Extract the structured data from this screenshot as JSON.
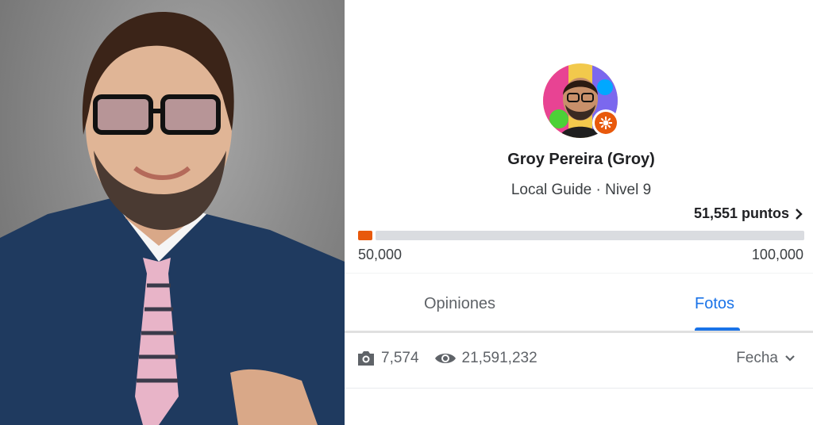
{
  "profile": {
    "name": "Groy Pereira (Groy)",
    "subtitle": "Local Guide · Nivel 9",
    "points_label": "51,551 puntos",
    "progress": {
      "min_label": "50,000",
      "max_label": "100,000",
      "value": 51551,
      "min": 50000,
      "max": 100000
    }
  },
  "tabs": [
    {
      "label": "Opiniones",
      "selected": false
    },
    {
      "label": "Fotos",
      "selected": true
    }
  ],
  "stats": {
    "photos_count": "7,574",
    "views_count": "21,591,232",
    "sort_label": "Fecha"
  },
  "icons": {
    "photo": "camera-icon",
    "views": "eye-icon",
    "sort": "chevron-down-icon",
    "points": "chevron-right-icon",
    "badge": "local-guide-badge-icon"
  },
  "colors": {
    "accent": "#1a73e8",
    "badge": "#e8590c",
    "progress_fill": "#e8590c",
    "progress_track": "#dadce0"
  }
}
